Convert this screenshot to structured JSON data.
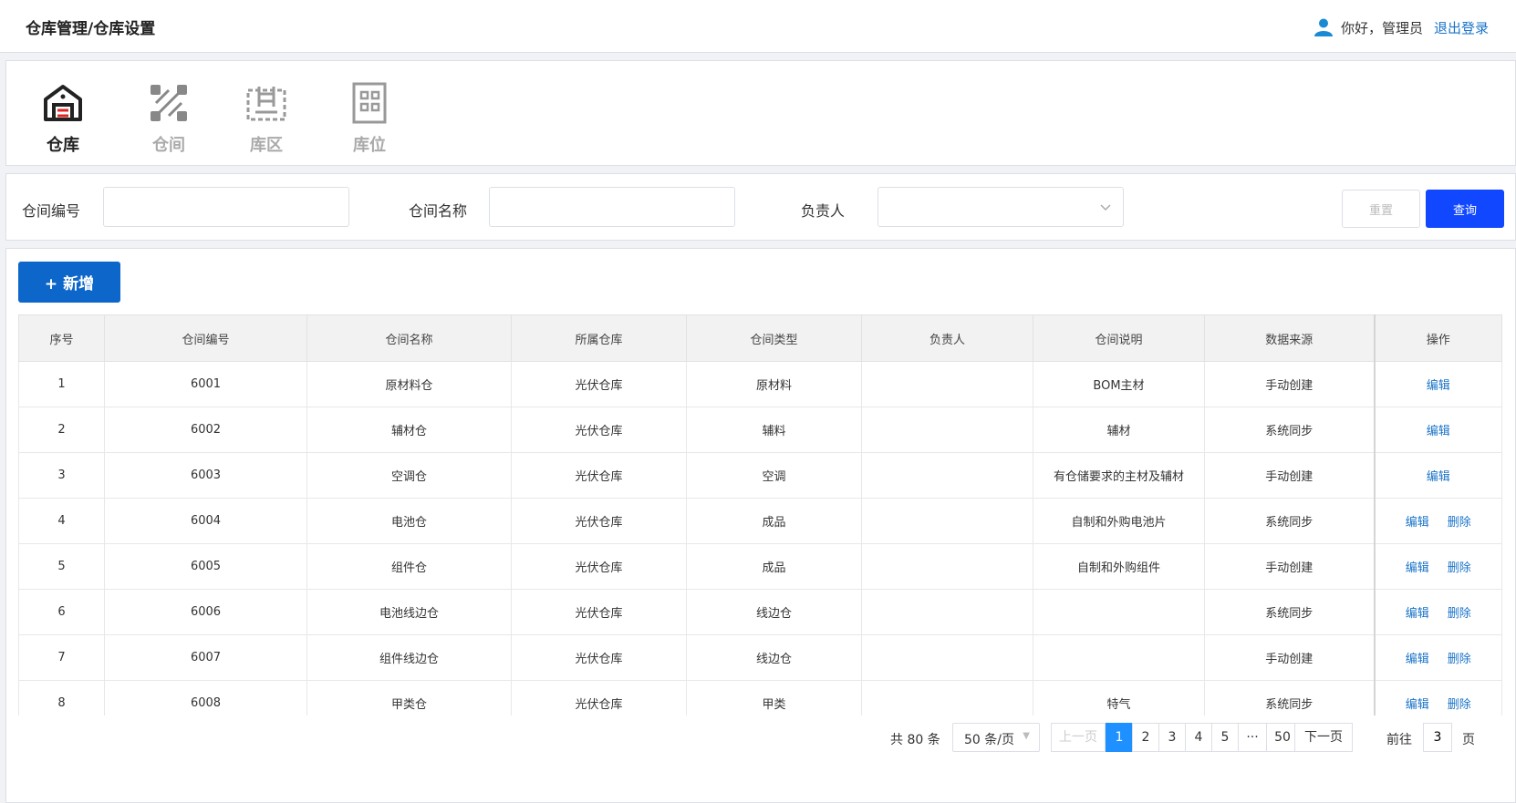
{
  "header": {
    "title": "仓库管理/仓库设置",
    "greeting": "你好，管理员",
    "logout": "退出登录"
  },
  "tabs": [
    {
      "label": "仓库",
      "icon": "warehouse-icon",
      "active": true
    },
    {
      "label": "仓间",
      "icon": "partition-icon",
      "active": false
    },
    {
      "label": "库区",
      "icon": "area-icon",
      "active": false
    },
    {
      "label": "库位",
      "icon": "location-icon",
      "active": false
    }
  ],
  "filters": {
    "code_label": "仓间编号",
    "code_value": "",
    "name_label": "仓间名称",
    "name_value": "",
    "owner_label": "负责人",
    "owner_value": "",
    "reset_label": "重置",
    "query_label": "查询"
  },
  "toolbar": {
    "add_label": "+ 新增"
  },
  "table": {
    "columns": [
      "序号",
      "仓间编号",
      "仓间名称",
      "所属仓库",
      "仓间类型",
      "负责人",
      "仓间说明",
      "数据来源",
      "操作"
    ],
    "edit_label": "编辑",
    "delete_label": "删除",
    "rows": [
      {
        "no": "1",
        "code": "6001",
        "name": "原材料仓",
        "warehouse": "光伏仓库",
        "type": "原材料",
        "owner": "",
        "desc": "BOM主材",
        "source": "手动创建",
        "deletable": false
      },
      {
        "no": "2",
        "code": "6002",
        "name": "辅材仓",
        "warehouse": "光伏仓库",
        "type": "辅料",
        "owner": "",
        "desc": "辅材",
        "source": "系统同步",
        "deletable": false
      },
      {
        "no": "3",
        "code": "6003",
        "name": "空调仓",
        "warehouse": "光伏仓库",
        "type": "空调",
        "owner": "",
        "desc": "有仓储要求的主材及辅材",
        "source": "手动创建",
        "deletable": false
      },
      {
        "no": "4",
        "code": "6004",
        "name": "电池仓",
        "warehouse": "光伏仓库",
        "type": "成品",
        "owner": "",
        "desc": "自制和外购电池片",
        "source": "系统同步",
        "deletable": true
      },
      {
        "no": "5",
        "code": "6005",
        "name": "组件仓",
        "warehouse": "光伏仓库",
        "type": "成品",
        "owner": "",
        "desc": "自制和外购组件",
        "source": "手动创建",
        "deletable": true
      },
      {
        "no": "6",
        "code": "6006",
        "name": "电池线边仓",
        "warehouse": "光伏仓库",
        "type": "线边仓",
        "owner": "",
        "desc": "",
        "source": "系统同步",
        "deletable": true
      },
      {
        "no": "7",
        "code": "6007",
        "name": "组件线边仓",
        "warehouse": "光伏仓库",
        "type": "线边仓",
        "owner": "",
        "desc": "",
        "source": "手动创建",
        "deletable": true
      },
      {
        "no": "8",
        "code": "6008",
        "name": "甲类仓",
        "warehouse": "光伏仓库",
        "type": "甲类",
        "owner": "",
        "desc": "特气",
        "source": "系统同步",
        "deletable": true
      }
    ]
  },
  "pagination": {
    "total": "共 80 条",
    "page_size": "50 条/页",
    "prev": "上一页",
    "next": "下一页",
    "pages": [
      "1",
      "2",
      "3",
      "4",
      "5",
      "···",
      "50"
    ],
    "current": "1",
    "goto_label": "前往",
    "goto_value": "3",
    "goto_unit": "页"
  }
}
